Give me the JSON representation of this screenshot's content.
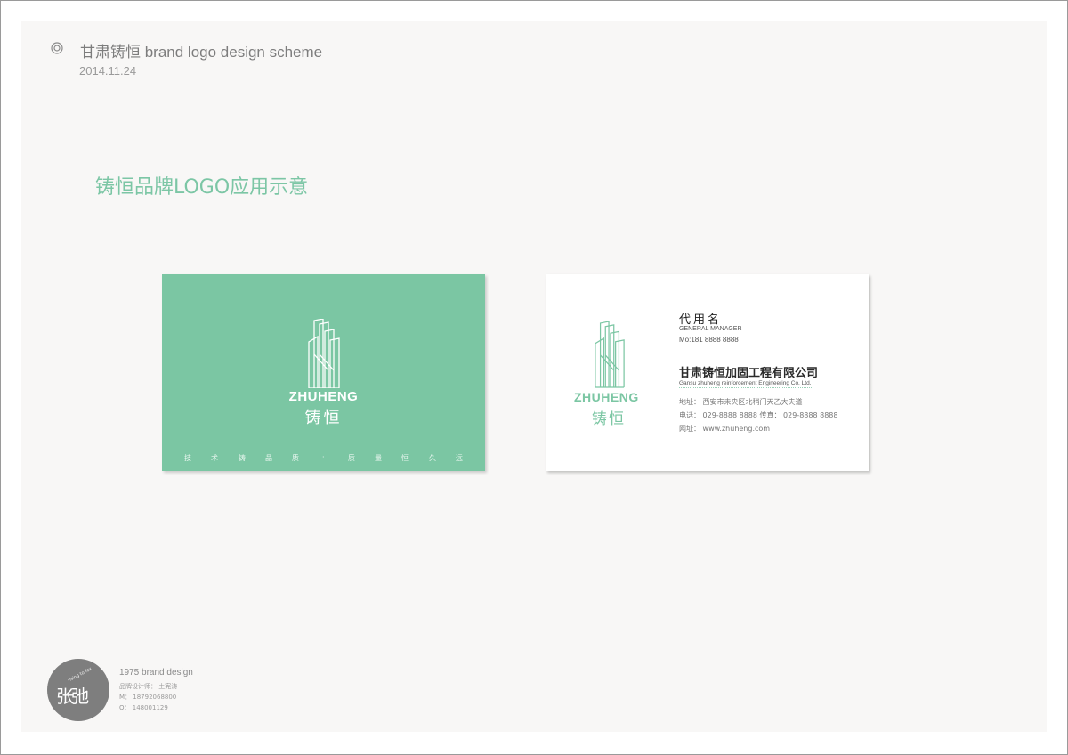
{
  "header": {
    "title": "甘肃铸恒 brand logo design scheme",
    "date": "2014.11.24"
  },
  "section_title": "铸恒品牌LOGO应用示意",
  "front_card": {
    "brand_en": "ZHUHENG",
    "brand_cn": "铸恒",
    "slogan": [
      "技",
      "术",
      "铸",
      "品",
      "质",
      "·",
      "质",
      "量",
      "恒",
      "久",
      "远"
    ]
  },
  "back_card": {
    "brand_en": "ZHUHENG",
    "brand_cn": "铸恒",
    "name": "代用名",
    "position": "GENERAL MANAGER",
    "mobile": "Mo:181 8888 8888",
    "company_cn": "甘肃铸恒加固工程有限公司",
    "company_en": "Gansu zhuheng reinforcement Engineering Co. Ltd.",
    "address": "地址：  西安市未央区北稍门天乙大夫道",
    "phone": "电话：  029-8888 8888   传真：  029-8888 8888",
    "website": "网址：  www.zhuheng.com"
  },
  "footer": {
    "badge_text": "张弛",
    "badge_small": "rising to fox",
    "title": "1975 brand design",
    "designer": "品牌设计师：  土宪涛",
    "mobile": "M：  18792068800",
    "qq": "Q：  148001129"
  },
  "colors": {
    "accent": "#7bc6a3",
    "sheet": "#f8f7f6",
    "badge": "#7e7e7e"
  }
}
